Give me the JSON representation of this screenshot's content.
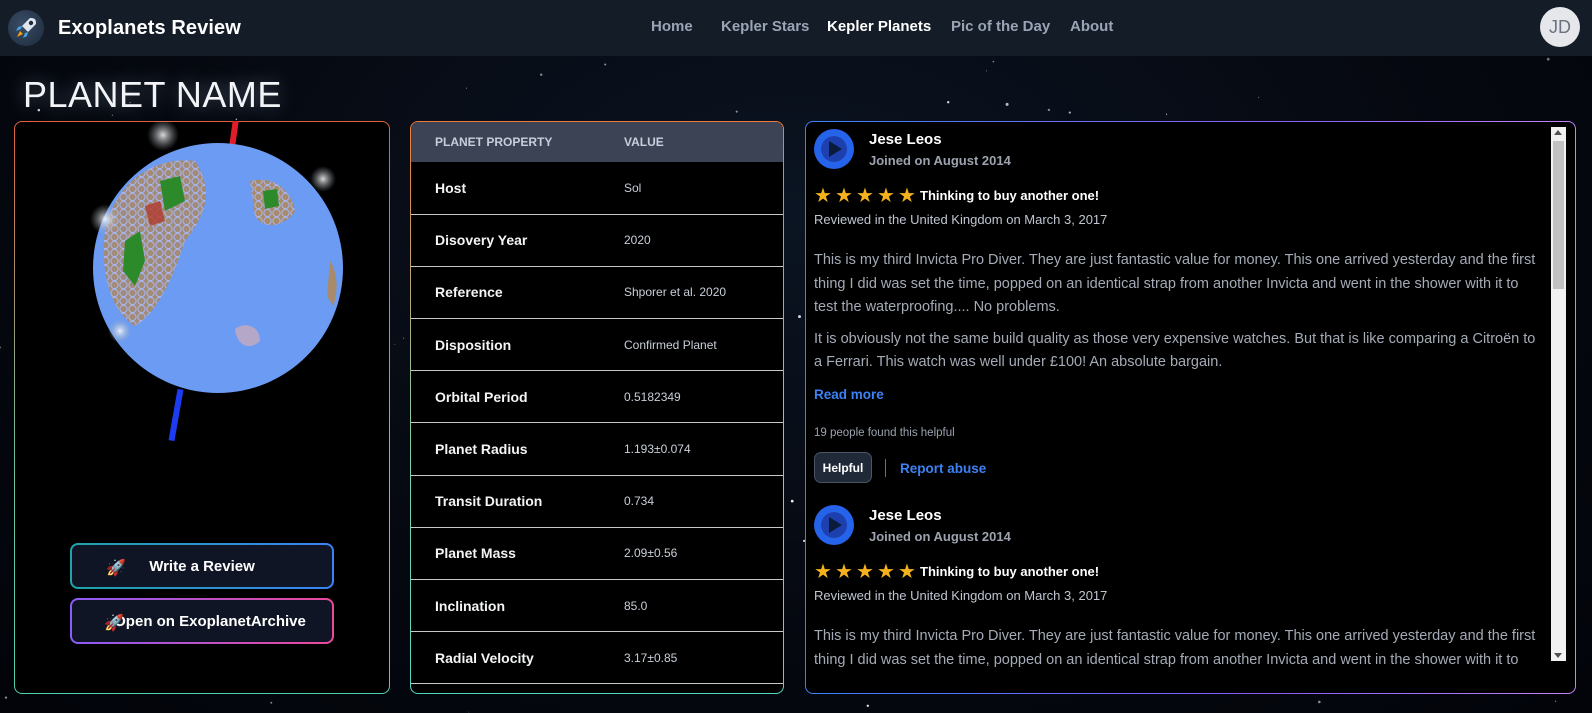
{
  "brand": {
    "title": "Exoplanets Review",
    "logo_icon": "rocket-icon"
  },
  "nav": {
    "links": [
      {
        "label": "Home",
        "active": false
      },
      {
        "label": "Kepler Stars",
        "active": false
      },
      {
        "label": "Kepler Planets",
        "active": true
      },
      {
        "label": "Pic of the Day",
        "active": false
      },
      {
        "label": "About",
        "active": false
      }
    ],
    "avatar_initials": "JD"
  },
  "page": {
    "title": "PLANET NAME"
  },
  "actions": {
    "write_review": "Write a Review",
    "open_archive": "Open on ExoplanetArchive",
    "icon": "rocket-icon"
  },
  "properties": {
    "header_property": "PLANET PROPERTY",
    "header_value": "VALUE",
    "rows": [
      {
        "key": "Host",
        "value": "Sol"
      },
      {
        "key": "Disovery Year",
        "value": "2020"
      },
      {
        "key": "Reference",
        "value": "Shporer et al. 2020"
      },
      {
        "key": "Disposition",
        "value": "Confirmed Planet"
      },
      {
        "key": "Orbital Period",
        "value": "0.5182349"
      },
      {
        "key": "Planet Radius",
        "value": "1.193±0.074"
      },
      {
        "key": "Transit Duration",
        "value": "0.734"
      },
      {
        "key": "Planet Mass",
        "value": "2.09±0.56"
      },
      {
        "key": "Inclination",
        "value": "85.0"
      },
      {
        "key": "Radial Velocity",
        "value": "3.17±0.85"
      }
    ]
  },
  "reviews": [
    {
      "name": "Jese Leos",
      "joined": "Joined on August 2014",
      "rating": 5,
      "title": "Thinking to buy another one!",
      "meta": "Reviewed in the United Kingdom on March 3, 2017",
      "body": [
        "This is my third Invicta Pro Diver. They are just fantastic value for money. This one arrived yesterday and the first thing I did was set the time, popped on an identical strap from another Invicta and went in the shower with it to test the waterproofing.... No problems.",
        "It is obviously not the same build quality as those very expensive watches. But that is like comparing a Citroën to a Ferrari. This watch was well under £100! An absolute bargain."
      ],
      "read_more": "Read more",
      "helpful_count": "19 people found this helpful",
      "helpful_label": "Helpful",
      "report_label": "Report abuse"
    },
    {
      "name": "Jese Leos",
      "joined": "Joined on August 2014",
      "rating": 5,
      "title": "Thinking to buy another one!",
      "meta": "Reviewed in the United Kingdom on March 3, 2017",
      "body": [
        "This is my third Invicta Pro Diver. They are just fantastic value for money. This one arrived yesterday and the first thing I did was set the time, popped on an identical strap from another Invicta and went in the shower with it to test the waterproofing.... No problems."
      ]
    }
  ],
  "colors": {
    "accent_blue": "#3b82f6",
    "star_gold": "#f6b11e",
    "planet_ocean": "#6b9bf2"
  }
}
